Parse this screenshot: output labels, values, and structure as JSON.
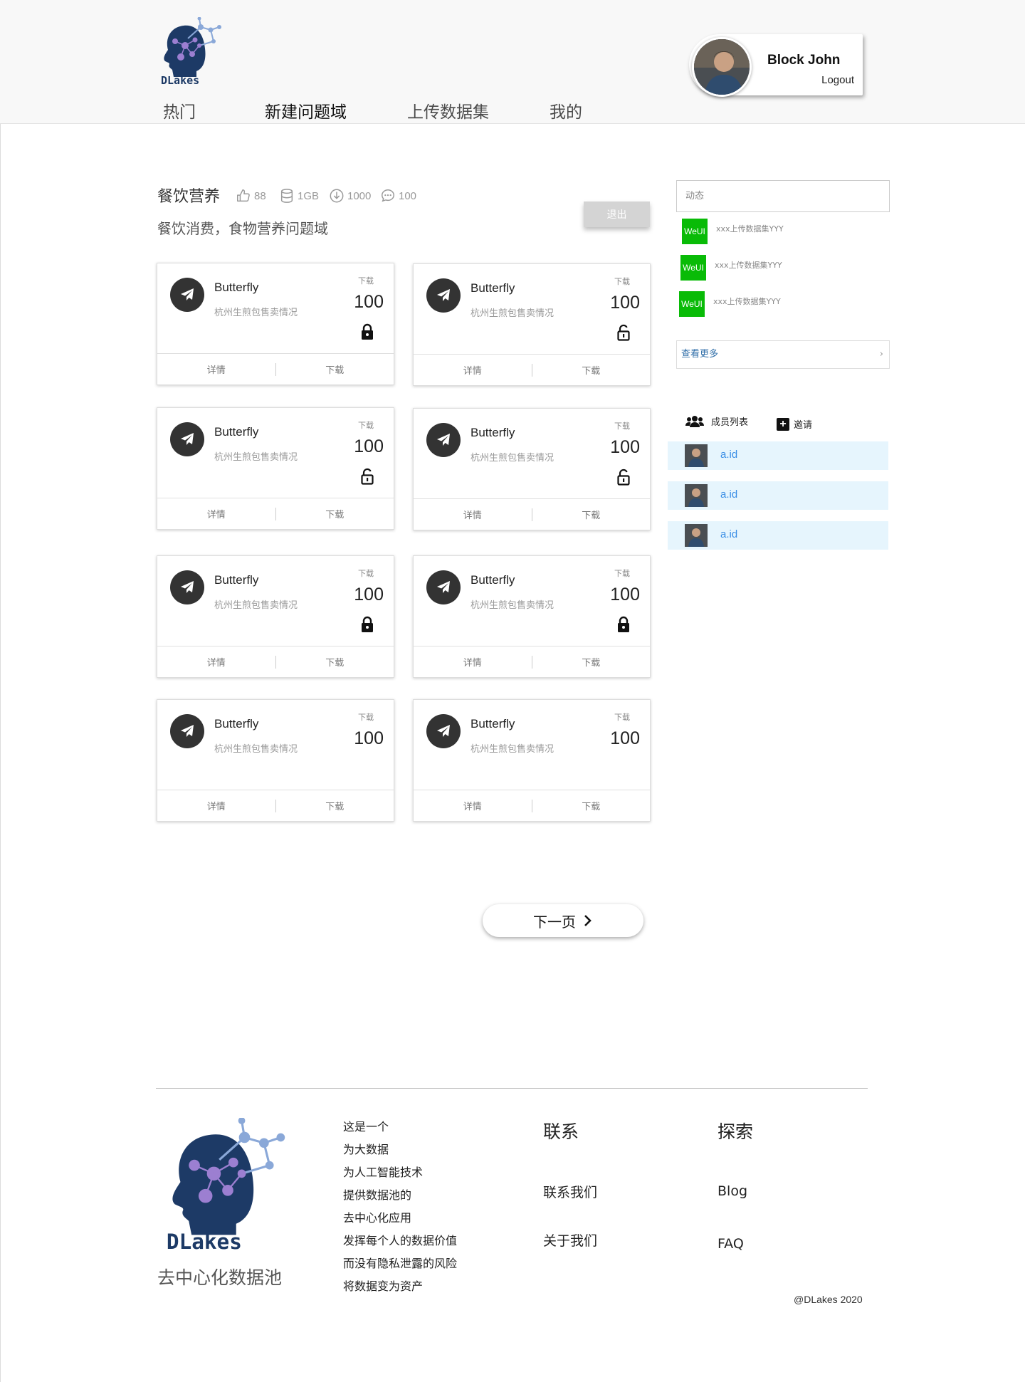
{
  "header": {
    "nav": [
      "热门",
      "新建问题域",
      "上传数据集",
      "我的"
    ],
    "user": {
      "name": "Block John",
      "logout": "Logout"
    }
  },
  "domain": {
    "title": "餐饮营养",
    "likes": "88",
    "size": "1GB",
    "downloads": "1000",
    "comments": "100",
    "description": "餐饮消费，食物营养问题域",
    "exit_label": "退出"
  },
  "cards": [
    {
      "title": "Butterfly",
      "subtitle": "杭州生煎包售卖情况",
      "download_label": "下载",
      "count": "100",
      "lock": "locked-icon",
      "detail": "详情",
      "download": "下载"
    },
    {
      "title": "Butterfly",
      "subtitle": "杭州生煎包售卖情况",
      "download_label": "下载",
      "count": "100",
      "lock": "unlocked-icon",
      "detail": "详情",
      "download": "下载"
    },
    {
      "title": "Butterfly",
      "subtitle": "杭州生煎包售卖情况",
      "download_label": "下载",
      "count": "100",
      "lock": "unlocked-icon",
      "detail": "详情",
      "download": "下载"
    },
    {
      "title": "Butterfly",
      "subtitle": "杭州生煎包售卖情况",
      "download_label": "下载",
      "count": "100",
      "lock": "unlocked-icon",
      "detail": "详情",
      "download": "下载"
    },
    {
      "title": "Butterfly",
      "subtitle": "杭州生煎包售卖情况",
      "download_label": "下载",
      "count": "100",
      "lock": "locked-icon",
      "detail": "详情",
      "download": "下载"
    },
    {
      "title": "Butterfly",
      "subtitle": "杭州生煎包售卖情况",
      "download_label": "下载",
      "count": "100",
      "lock": "locked-icon",
      "detail": "详情",
      "download": "下载"
    },
    {
      "title": "Butterfly",
      "subtitle": "杭州生煎包售卖情况",
      "download_label": "下载",
      "count": "100",
      "lock": "none",
      "detail": "详情",
      "download": "下载"
    },
    {
      "title": "Butterfly",
      "subtitle": "杭州生煎包售卖情况",
      "download_label": "下载",
      "count": "100",
      "lock": "none",
      "detail": "详情",
      "download": "下载"
    }
  ],
  "pager": {
    "next_label": "下一页"
  },
  "sidebar": {
    "activity_placeholder": "动态",
    "feed": [
      {
        "badge": "WeUI",
        "text": "xxx上传数据集YYY"
      },
      {
        "badge": "WeUI",
        "text": "xxx上传数据集YYY"
      },
      {
        "badge": "WeUI",
        "text": "xxx上传数据集YYY"
      }
    ],
    "see_more": "查看更多",
    "members_label": "成员列表",
    "invite_label": "邀请",
    "members": [
      "a.id",
      "a.id",
      "a.id"
    ]
  },
  "footer": {
    "tagline": "去中心化数据池",
    "about": [
      "这是一个",
      "为大数据",
      "为人工智能技术",
      "提供数据池的",
      "去中心化应用",
      "发挥每个人的数据价值",
      "而没有隐私泄露的风险",
      "将数据变为资产"
    ],
    "contact_heading": "联系",
    "contact_links": [
      "联系我们",
      "关于我们"
    ],
    "explore_heading": "探索",
    "explore_links": [
      "Blog",
      "FAQ"
    ],
    "copyright": "@DLakes 2020"
  },
  "colors": {
    "weui_green": "#09bb07",
    "member_row_bg": "#e6f5fd",
    "member_link": "#3a8ee6",
    "logo_navy": "#1d3a66",
    "logo_purple": "#9c7fd1"
  }
}
